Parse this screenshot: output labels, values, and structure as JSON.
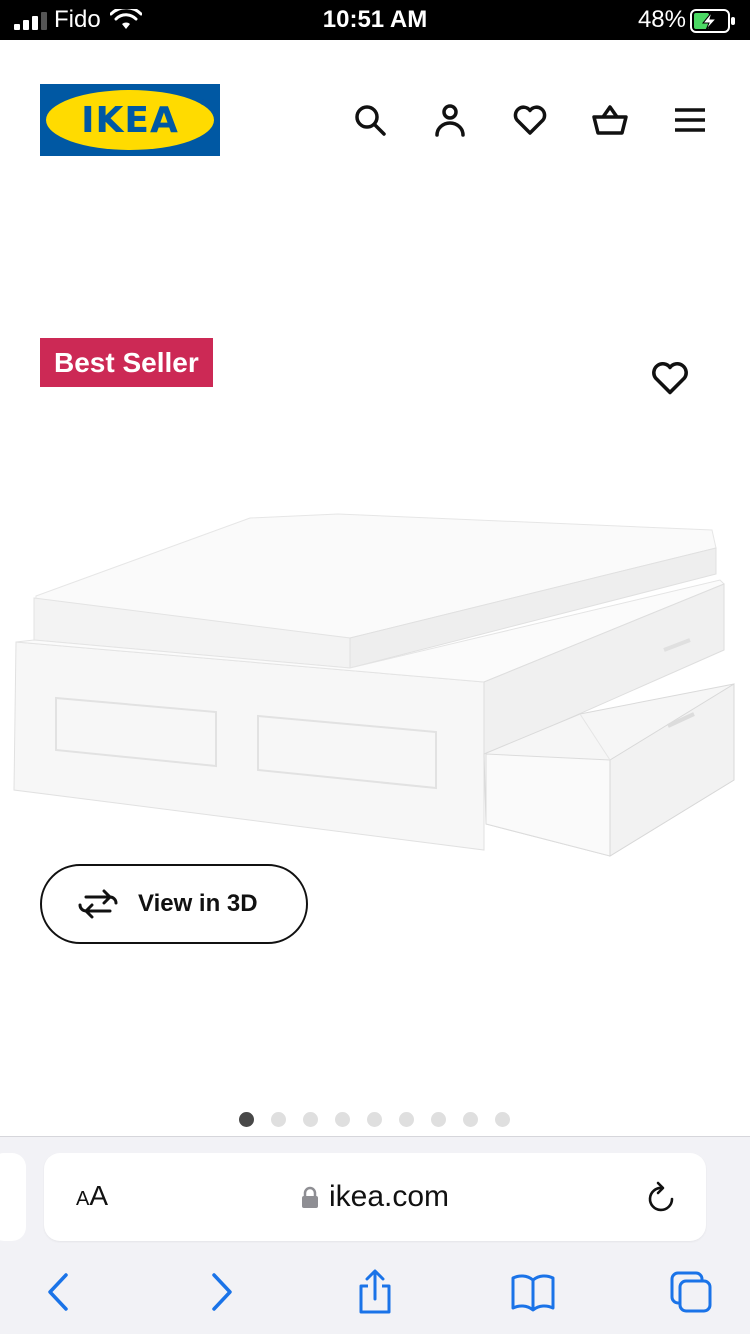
{
  "status_bar": {
    "carrier": "Fido",
    "time": "10:51 AM",
    "battery_percent": "48%",
    "battery_level": 0.48,
    "icons": [
      "signal-icon",
      "wifi-icon",
      "battery-charging-icon"
    ]
  },
  "header": {
    "logo_text": "IKEA",
    "logo_registered": "®",
    "icons": [
      "search-icon",
      "account-icon",
      "wishlist-icon",
      "shopping-basket-icon",
      "menu-icon"
    ],
    "colors": {
      "logo_blue": "#0058a3",
      "logo_yellow": "#ffdb00"
    }
  },
  "product": {
    "badge": "Best Seller",
    "badge_color": "#cc2955",
    "favorite_icon": "heart-outline-icon",
    "image_icon": "bed-with-storage-drawers",
    "view_3d_label": "View in 3D",
    "view_3d_icon": "rotate-arrows-icon",
    "gallery": {
      "total_images": 9,
      "active_index": 0
    }
  },
  "browser": {
    "text_size_label_small": "A",
    "text_size_label_large": "A",
    "url": "ikea.com",
    "icons": [
      "lock-icon",
      "reload-icon",
      "back-icon",
      "forward-icon",
      "share-icon",
      "bookmarks-icon",
      "tabs-icon"
    ],
    "accent_color": "#1a73e8"
  }
}
